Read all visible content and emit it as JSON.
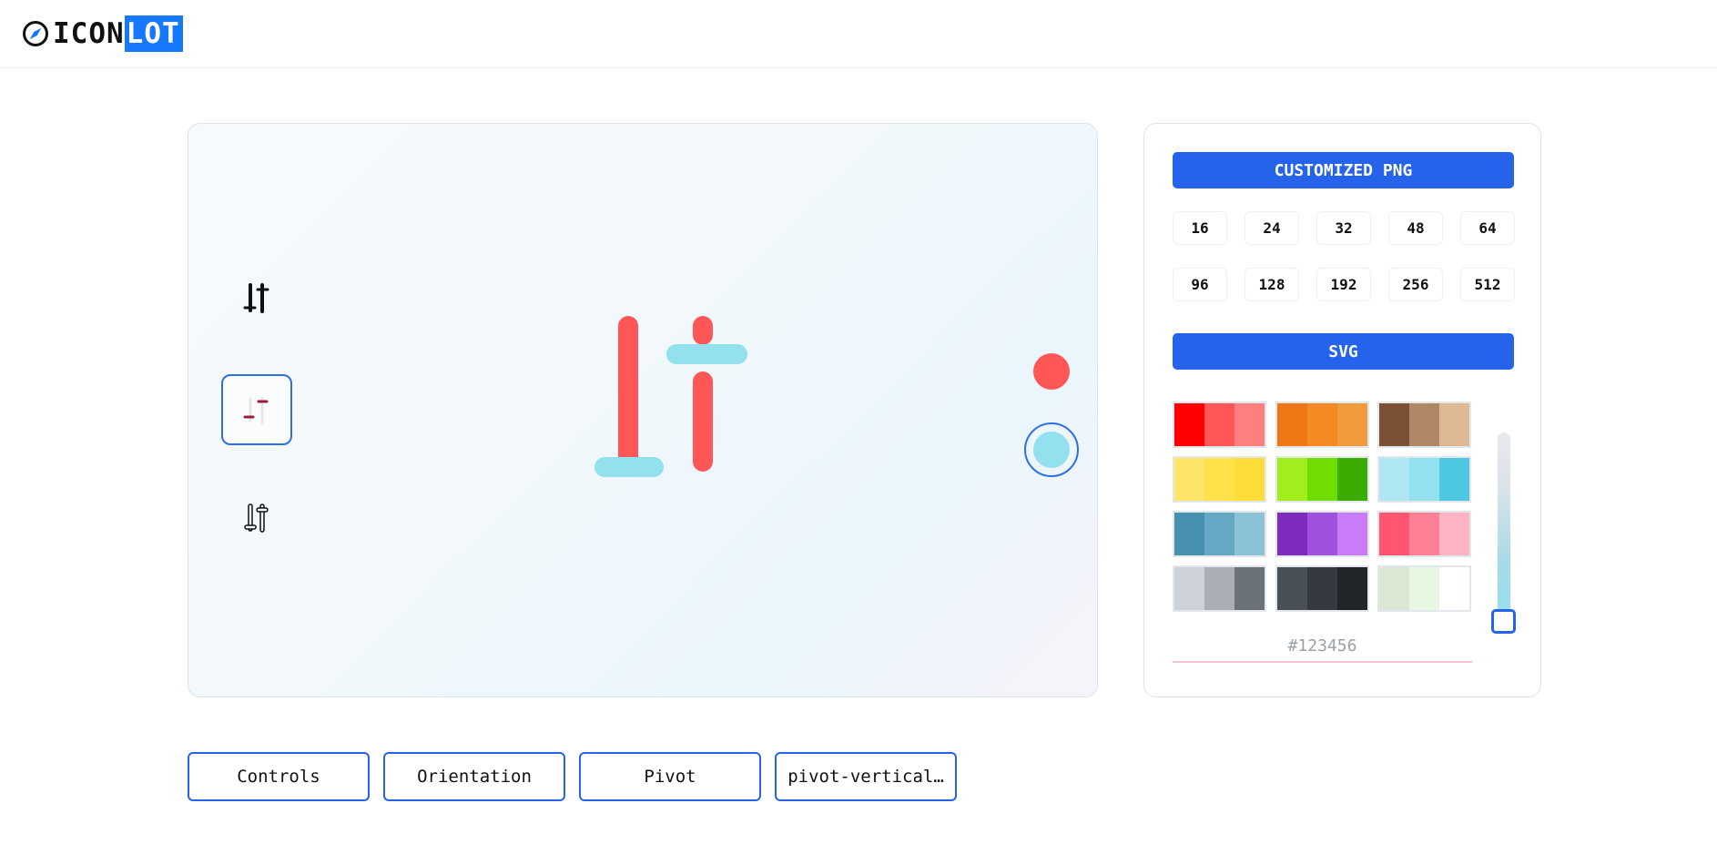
{
  "header": {
    "logo_icon": "compass-icon",
    "logo_text_a": "ICON",
    "logo_text_b": "LOT",
    "accent": "#1677ff"
  },
  "preview": {
    "variants": [
      {
        "icon": "pivot-vertical-solid-icon",
        "selected": false
      },
      {
        "icon": "pivot-vertical-duotone-icon",
        "selected": true
      },
      {
        "icon": "pivot-vertical-outline-icon",
        "selected": false
      }
    ],
    "main_icon": "pivot-vertical-icon",
    "primary_color": "#ff5757",
    "secondary_color": "#93e0ef",
    "color_dots": [
      {
        "color": "#ff5757",
        "selected": false
      },
      {
        "color": "#93e0ef",
        "selected": true
      }
    ]
  },
  "download": {
    "png_label": "CUSTOMIZED PNG",
    "svg_label": "SVG",
    "sizes": [
      "16",
      "24",
      "32",
      "48",
      "64",
      "96",
      "128",
      "192",
      "256",
      "512"
    ],
    "button_color": "#2563eb"
  },
  "palettes": [
    [
      "#ff0000",
      "#ff5757",
      "#ff7f7f"
    ],
    [
      "#f07814",
      "#f58a22",
      "#f29b3c"
    ],
    [
      "#7c5035",
      "#b08868",
      "#dfb993"
    ],
    [
      "#ffe46a",
      "#ffe14a",
      "#fdde38"
    ],
    [
      "#a2ed1c",
      "#6fdd00",
      "#3aad00"
    ],
    [
      "#aee7f2",
      "#93e0ef",
      "#4ec8e0"
    ],
    [
      "#4890b0",
      "#64a8c4",
      "#8cc2d8"
    ],
    [
      "#7d2cbe",
      "#a052de",
      "#c87cf8"
    ],
    [
      "#ff5571",
      "#ff7f95",
      "#ffb4c3"
    ],
    [
      "#cdd2d8",
      "#a9afb5",
      "#6b7178"
    ],
    [
      "#495057",
      "#343a40",
      "#212529"
    ],
    [
      "#dbe6d3",
      "#e8f7e2",
      "#ffffff"
    ]
  ],
  "hex_input": {
    "value": "",
    "placeholder": "#123456"
  },
  "opacity_slider": {
    "value": 1.0
  },
  "tags": [
    "Controls",
    "Orientation",
    "Pivot",
    "pivot-vertical…"
  ]
}
